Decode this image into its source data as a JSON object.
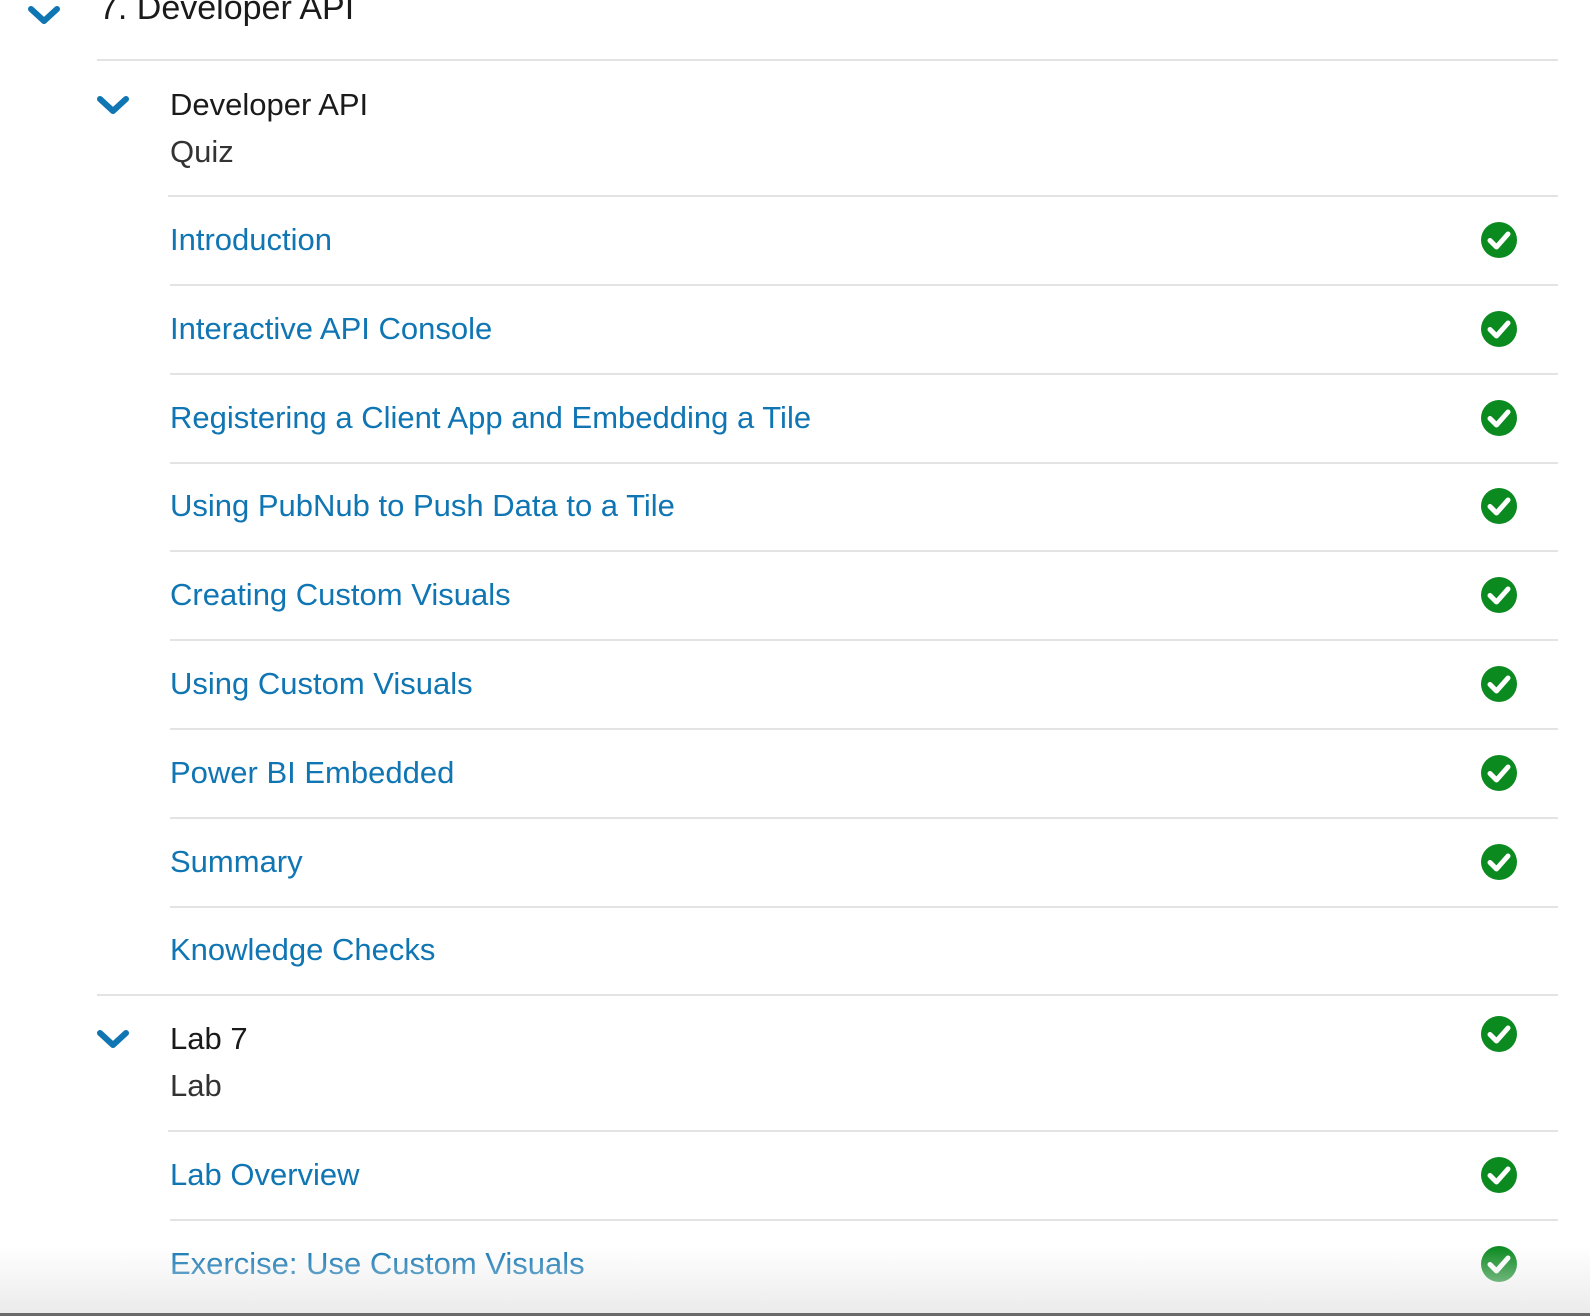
{
  "module": {
    "title": "7. Developer API",
    "expand_icon": "chevron-down-icon"
  },
  "accent_color": "#0f75b3",
  "check_color": "#0a8a1f",
  "sections": [
    {
      "title": "Developer API",
      "type": "Quiz",
      "completed": false,
      "lessons": [
        {
          "label": "Introduction",
          "completed": true
        },
        {
          "label": "Interactive API Console",
          "completed": true
        },
        {
          "label": "Registering a Client App and Embedding a Tile",
          "completed": true
        },
        {
          "label": "Using PubNub to Push Data to a Tile",
          "completed": true
        },
        {
          "label": "Creating Custom Visuals",
          "completed": true
        },
        {
          "label": "Using Custom Visuals",
          "completed": true
        },
        {
          "label": "Power BI Embedded",
          "completed": true
        },
        {
          "label": "Summary",
          "completed": true
        },
        {
          "label": "Knowledge Checks",
          "completed": false
        }
      ]
    },
    {
      "title": "Lab 7",
      "type": "Lab",
      "completed": true,
      "lessons": [
        {
          "label": "Lab Overview",
          "completed": true
        },
        {
          "label": "Exercise: Use Custom Visuals",
          "completed": true
        }
      ]
    }
  ]
}
